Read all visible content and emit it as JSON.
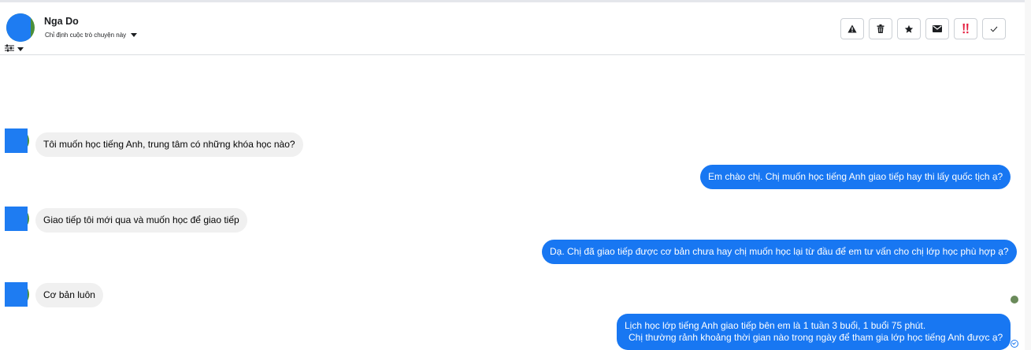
{
  "header": {
    "contact_name": "Nga Do",
    "assign_label": "Chỉ định cuộc trò chuyện này",
    "actions": [
      {
        "name": "report-button",
        "icon": "warning-icon"
      },
      {
        "name": "delete-button",
        "icon": "trash-icon"
      },
      {
        "name": "star-button",
        "icon": "star-icon"
      },
      {
        "name": "mark-unread-button",
        "icon": "envelope-icon"
      },
      {
        "name": "priority-button",
        "icon": "double-exclamation-icon"
      },
      {
        "name": "mark-done-button",
        "icon": "checkmark-icon"
      }
    ]
  },
  "messages": [
    {
      "direction": "in",
      "text": "Tôi muốn học tiếng Anh, trung tâm có những khóa học nào?"
    },
    {
      "direction": "out",
      "text": "Em chào chị. Chị muốn học tiếng Anh giao tiếp hay thi lấy quốc tịch ạ?"
    },
    {
      "direction": "in",
      "text": "Giao tiếp tôi mới qua và muốn học để giao tiếp"
    },
    {
      "direction": "out",
      "text": "Dạ. Chị đã giao tiếp được cơ bản chưa hay chị muốn học lại từ đầu để em tư vấn cho chị lớp học phù hợp ạ?"
    },
    {
      "direction": "in",
      "text": "Cơ bản luôn"
    },
    {
      "direction": "out",
      "lines": [
        "Lịch học lớp tiếng Anh giao tiếp bên em là 1 tuần 3 buổi, 1 buổi 75 phút.",
        "Chị thường rảnh khoảng thời gian nào trong ngày để tham gia lớp học tiếng Anh được ạ?"
      ]
    }
  ],
  "colors": {
    "outgoing_bubble": "#1877f2",
    "incoming_bubble": "#f0f0f0",
    "avatar_fill": "#1e7cf2",
    "priority_icon": "#e41e3f"
  }
}
